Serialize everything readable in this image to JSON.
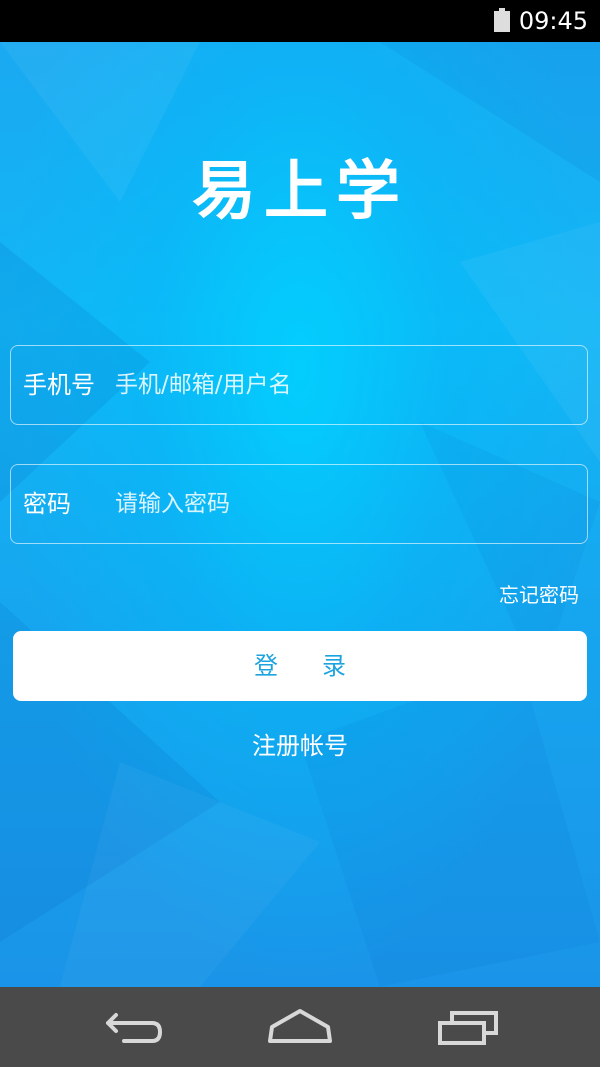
{
  "status_bar": {
    "time": "09:45",
    "battery_icon": "battery-icon"
  },
  "app": {
    "logo_text": "易上学"
  },
  "form": {
    "phone": {
      "label": "手机号",
      "placeholder": "手机/邮箱/用户名",
      "value": ""
    },
    "password": {
      "label": "密码",
      "placeholder": "请输入密码",
      "value": ""
    },
    "forgot_label": "忘记密码",
    "login_label": "登录",
    "register_label": "注册帐号"
  },
  "nav": {
    "back_icon": "back-icon",
    "home_icon": "home-icon",
    "recent_icon": "recent-apps-icon"
  },
  "colors": {
    "background_primary": "#12b7f6",
    "background_dark": "#1a94e8",
    "button_text": "#1da3df",
    "nav_bar": "#4a4a4a"
  }
}
